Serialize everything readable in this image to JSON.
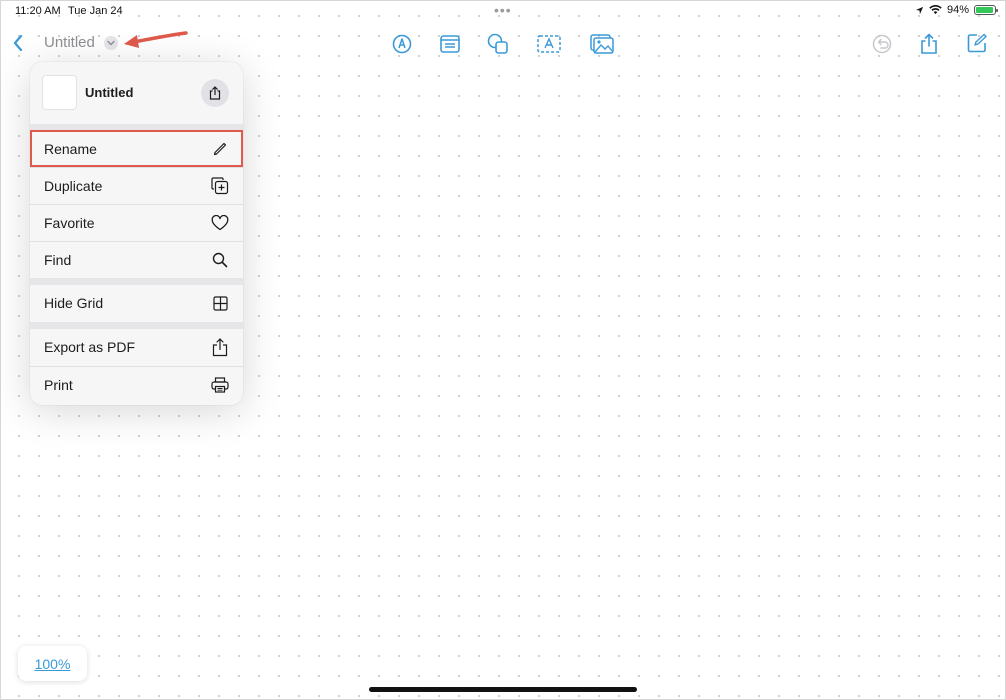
{
  "status_bar": {
    "time": "11:20 AM",
    "date": "Tue Jan 24",
    "multitask": "•••",
    "battery": "94%",
    "battery_level": 0.94
  },
  "toolbar": {
    "back_icon": "chevron-left-icon",
    "title": "Untitled",
    "title_menu_icon": "chevron-down-icon",
    "tools": [
      "pen-tool-icon",
      "note-icon",
      "shapes-icon",
      "text-box-icon",
      "media-icon"
    ],
    "right": [
      "undo-icon",
      "share-icon",
      "new-board-icon"
    ],
    "accent": "#3a9ad9",
    "annotation_arrow_color": "#e05a4c"
  },
  "menu": {
    "board_title": "Untitled",
    "share_icon": "share-icon",
    "items": [
      {
        "label": "Rename",
        "icon": "pencil-icon",
        "highlighted": true
      },
      {
        "label": "Duplicate",
        "icon": "duplicate-icon"
      },
      {
        "label": "Favorite",
        "icon": "heart-icon"
      },
      {
        "label": "Find",
        "icon": "magnifier-icon"
      },
      {
        "label": "Hide Grid",
        "icon": "grid-icon"
      },
      {
        "label": "Export as PDF",
        "icon": "export-icon"
      },
      {
        "label": "Print",
        "icon": "printer-icon"
      }
    ]
  },
  "zoom": {
    "label": "100%"
  }
}
